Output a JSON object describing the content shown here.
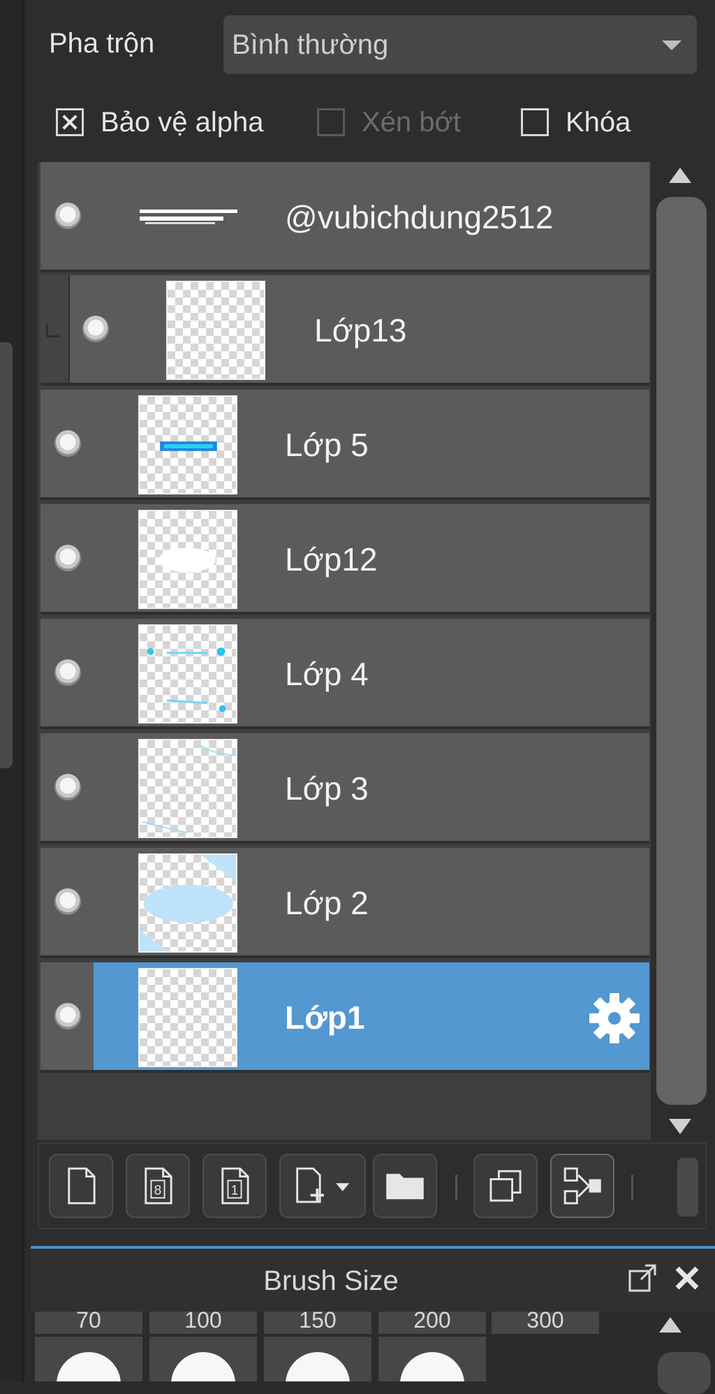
{
  "blend": {
    "label": "Pha trộn",
    "value": "Bình thường"
  },
  "options": [
    {
      "label": "Bảo vệ alpha",
      "checked": true,
      "enabled": true
    },
    {
      "label": "Xén bớt",
      "checked": false,
      "enabled": false
    },
    {
      "label": "Khóa",
      "checked": false,
      "enabled": true
    }
  ],
  "layers": [
    {
      "name": "@vubichdung2512",
      "type": "text",
      "selected": false,
      "clipped": false
    },
    {
      "name": "Lớp13",
      "type": "raster",
      "selected": false,
      "clipped": true
    },
    {
      "name": "Lớp 5",
      "type": "raster",
      "selected": false,
      "clipped": false
    },
    {
      "name": "Lớp12",
      "type": "raster",
      "selected": false,
      "clipped": false
    },
    {
      "name": "Lớp 4",
      "type": "raster",
      "selected": false,
      "clipped": false
    },
    {
      "name": "Lớp 3",
      "type": "raster",
      "selected": false,
      "clipped": false
    },
    {
      "name": "Lớp 2",
      "type": "raster",
      "selected": false,
      "clipped": false
    },
    {
      "name": "Lớp1",
      "type": "raster",
      "selected": true,
      "clipped": false
    }
  ],
  "toolbar": {
    "icons": [
      "new-layer-icon",
      "new-8bit-layer-icon",
      "new-1bit-layer-icon",
      "add-layer-menu-icon",
      "new-folder-icon",
      "duplicate-layer-icon",
      "merge-layer-icon"
    ]
  },
  "brush_size": {
    "title": "Brush Size",
    "sizes": [
      "70",
      "100",
      "150",
      "200",
      "300"
    ]
  },
  "colors": {
    "selected": "#5398d0",
    "row": "#5b5b5b",
    "accent": "#4a8fc9"
  }
}
